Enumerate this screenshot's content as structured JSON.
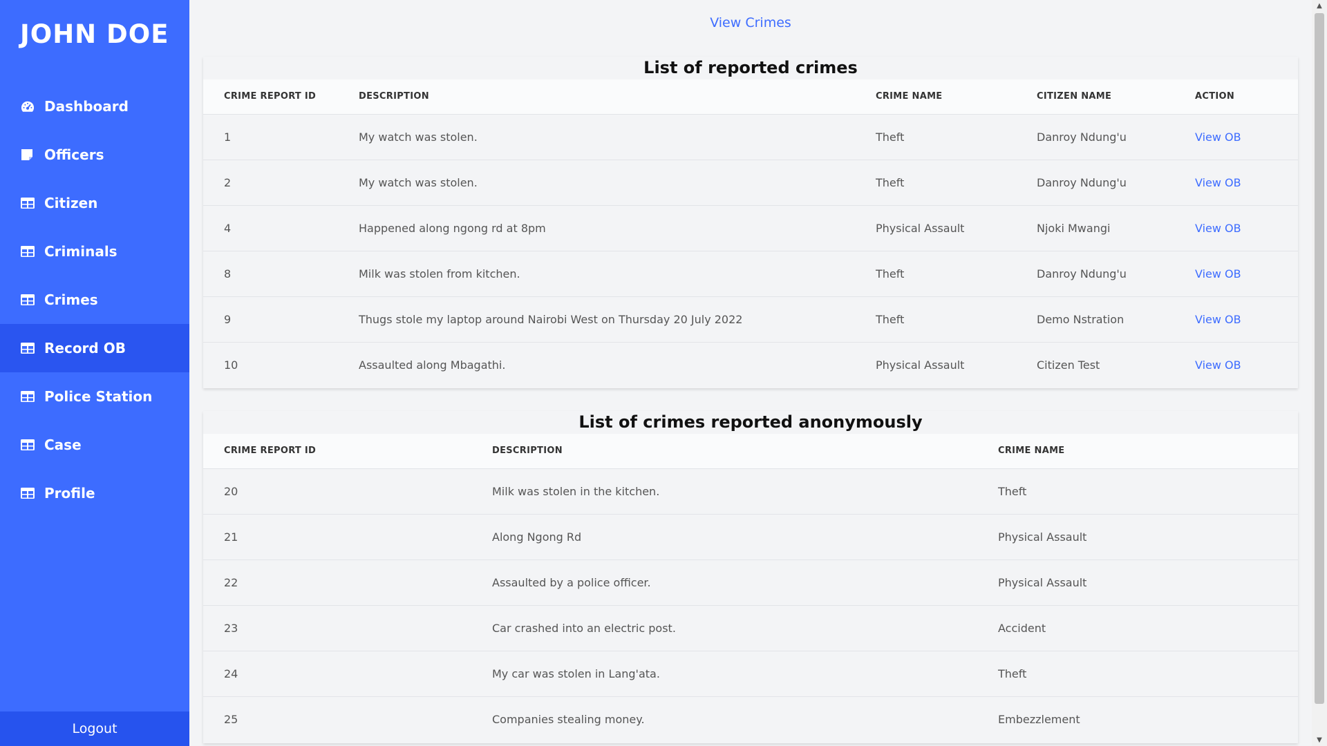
{
  "sidebar": {
    "brand": "JOHN DOE",
    "items": [
      {
        "label": "Dashboard",
        "icon": "dashboard-icon"
      },
      {
        "label": "Officers",
        "icon": "note-icon"
      },
      {
        "label": "Citizen",
        "icon": "table-icon"
      },
      {
        "label": "Criminals",
        "icon": "table-icon"
      },
      {
        "label": "Crimes",
        "icon": "table-icon"
      },
      {
        "label": "Record OB",
        "icon": "table-icon",
        "active": true
      },
      {
        "label": "Police Station",
        "icon": "table-icon"
      },
      {
        "label": "Case",
        "icon": "table-icon"
      },
      {
        "label": "Profile",
        "icon": "table-icon"
      }
    ],
    "logout": "Logout"
  },
  "header": {
    "link": "View Crimes"
  },
  "reported": {
    "title": "List of reported crimes",
    "columns": [
      "CRIME REPORT ID",
      "DESCRIPTION",
      "CRIME NAME",
      "CITIZEN NAME",
      "ACTION"
    ],
    "rows": [
      {
        "id": "1",
        "description": "My watch was stolen.",
        "crime": "Theft",
        "citizen": "Danroy Ndung'u",
        "action": "View OB"
      },
      {
        "id": "2",
        "description": "My watch was stolen.",
        "crime": "Theft",
        "citizen": "Danroy Ndung'u",
        "action": "View OB"
      },
      {
        "id": "4",
        "description": "Happened along ngong rd at 8pm",
        "crime": "Physical Assault",
        "citizen": "Njoki Mwangi",
        "action": "View OB"
      },
      {
        "id": "8",
        "description": "Milk was stolen from kitchen.",
        "crime": "Theft",
        "citizen": "Danroy Ndung'u",
        "action": "View OB"
      },
      {
        "id": "9",
        "description": "Thugs stole my laptop around Nairobi West on Thursday 20 July 2022",
        "crime": "Theft",
        "citizen": "Demo Nstration",
        "action": "View OB"
      },
      {
        "id": "10",
        "description": "Assaulted along Mbagathi.",
        "crime": "Physical Assault",
        "citizen": "Citizen Test",
        "action": "View OB"
      }
    ]
  },
  "anonymous": {
    "title": "List of crimes reported anonymously",
    "columns": [
      "CRIME REPORT ID",
      "DESCRIPTION",
      "CRIME NAME"
    ],
    "rows": [
      {
        "id": "20",
        "description": "Milk was stolen in the kitchen.",
        "crime": "Theft"
      },
      {
        "id": "21",
        "description": "Along Ngong Rd",
        "crime": "Physical Assault"
      },
      {
        "id": "22",
        "description": "Assaulted by a police officer.",
        "crime": "Physical Assault"
      },
      {
        "id": "23",
        "description": "Car crashed into an electric post.",
        "crime": "Accident"
      },
      {
        "id": "24",
        "description": "My car was stolen in Lang'ata.",
        "crime": "Theft"
      },
      {
        "id": "25",
        "description": "Companies stealing money.",
        "crime": "Embezzlement"
      }
    ]
  },
  "colors": {
    "sidebar": "#3d6cff",
    "sidebar_active": "#2a55f0",
    "logout": "#2653ee",
    "link": "#3d6cff",
    "background": "#f3f4f6"
  }
}
